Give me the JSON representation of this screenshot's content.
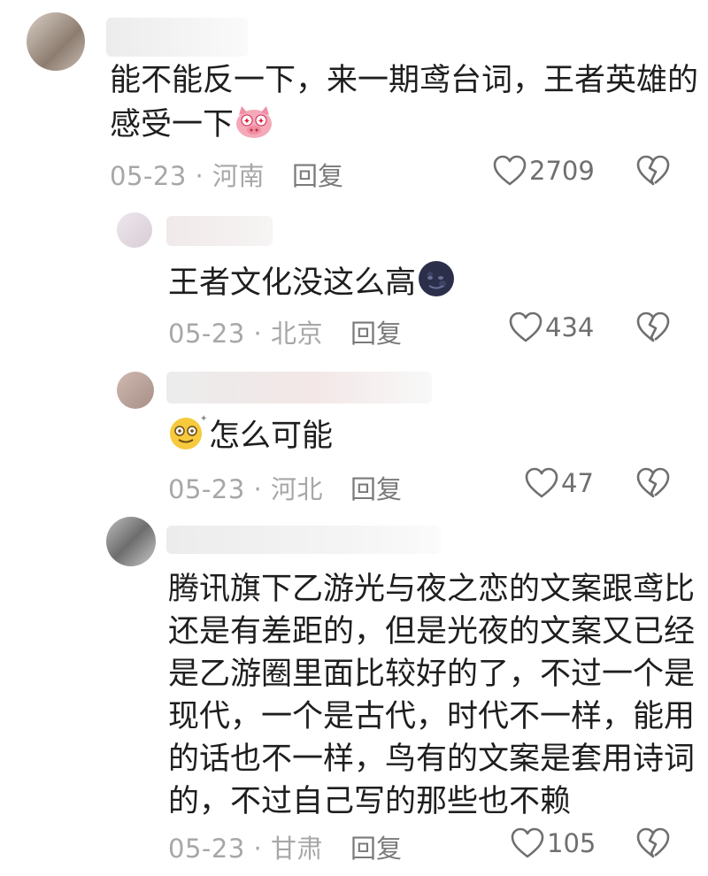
{
  "comments": [
    {
      "text_line1": "能不能反一下，来一期鸢台词，王者英雄的",
      "text_line2": "感受一下",
      "date": "05-23",
      "location": "河南",
      "reply_label": "回复",
      "likes": "2709",
      "emoji": "pig-face"
    },
    {
      "text": "王者文化没这么高",
      "date": "05-23",
      "location": "北京",
      "reply_label": "回复",
      "likes": "434",
      "emoji": "new-moon-face"
    },
    {
      "text": "怎么可能",
      "date": "05-23",
      "location": "河北",
      "reply_label": "回复",
      "likes": "47",
      "emoji": "dizzy-face"
    },
    {
      "lines": [
        "腾讯旗下乙游光与夜之恋的文案跟鸢比",
        "还是有差距的，但是光夜的文案又已经",
        "是乙游圈里面比较好的了，不过一个是",
        "现代，一个是古代，时代不一样，能用",
        "的话也不一样，鸟有的文案是套用诗词",
        "的，不过自己写的那些也不赖"
      ],
      "date": "05-23",
      "location": "甘肃",
      "reply_label": "回复",
      "likes": "105"
    }
  ],
  "separator": " · ",
  "colors": {
    "text": "#1e1e1e",
    "meta": "#a7a7a7",
    "icon": "#6f6f6f"
  }
}
